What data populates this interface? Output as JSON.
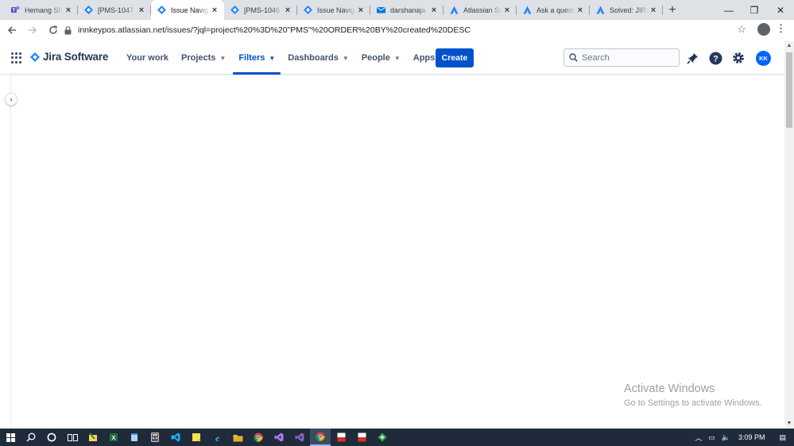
{
  "browser": {
    "tabs": [
      {
        "title": "Hemang Sh",
        "icon": "teams-icon",
        "active": false
      },
      {
        "title": "[PMS-1047",
        "icon": "jira-icon",
        "active": false
      },
      {
        "title": "Issue Navig",
        "icon": "jira-icon",
        "active": true
      },
      {
        "title": "[PMS-1046",
        "icon": "jira-icon",
        "active": false
      },
      {
        "title": "Issue Navig",
        "icon": "jira-icon",
        "active": false
      },
      {
        "title": "darshanaja",
        "icon": "mail-icon",
        "active": false
      },
      {
        "title": "Atlassian Su",
        "icon": "atlassian-icon",
        "active": false
      },
      {
        "title": "Ask a questi",
        "icon": "atlassian-icon",
        "active": false
      },
      {
        "title": "Solved: JIRA",
        "icon": "atlassian-icon",
        "active": false
      }
    ],
    "url": "innkeypos.atlassian.net/issues/?jql=project%20%3D%20\"PMS\"%20ORDER%20BY%20created%20DESC"
  },
  "jira": {
    "product_name": "Jira Software",
    "nav": [
      {
        "label": "Your work",
        "dropdown": false,
        "active": false
      },
      {
        "label": "Projects",
        "dropdown": true,
        "active": false
      },
      {
        "label": "Filters",
        "dropdown": true,
        "active": true
      },
      {
        "label": "Dashboards",
        "dropdown": true,
        "active": false
      },
      {
        "label": "People",
        "dropdown": true,
        "active": false
      },
      {
        "label": "Apps",
        "dropdown": true,
        "active": false
      }
    ],
    "create_label": "Create",
    "search_placeholder": "Search",
    "avatar_initials": "KK",
    "accent_color": "#0052cc"
  },
  "watermark": {
    "line1": "Activate Windows",
    "line2": "Go to Settings to activate Windows."
  },
  "taskbar": {
    "time": "3:09 PM"
  }
}
